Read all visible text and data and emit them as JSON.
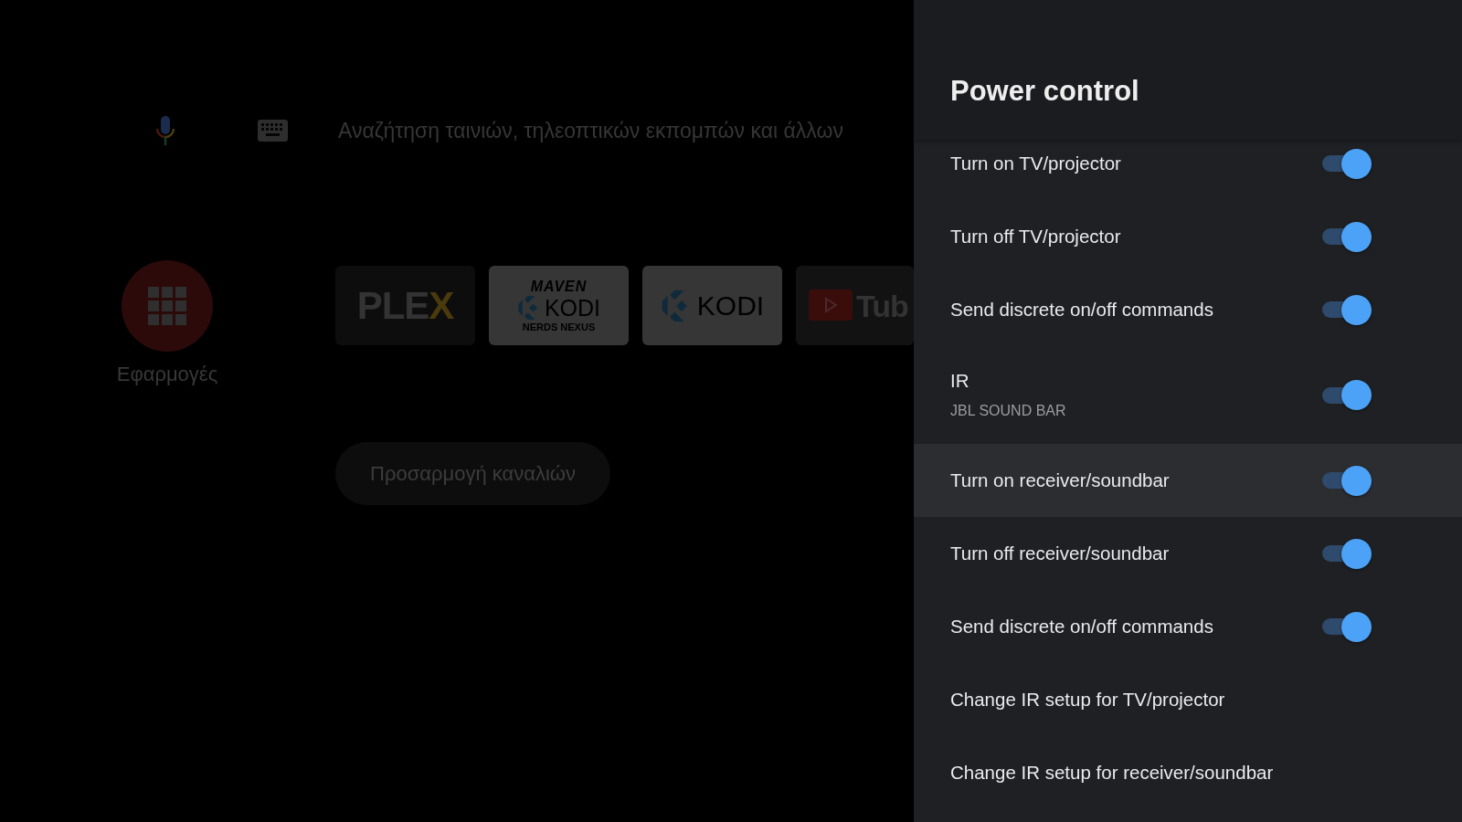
{
  "home": {
    "search": {
      "placeholder": "Αναζήτηση ταινιών, τηλεοπτικών εκπομπών και άλλων"
    },
    "apps_button": {
      "label": "Εφαρμογές"
    },
    "app_tiles": [
      {
        "kind": "plex",
        "texts": [
          "PLEX"
        ]
      },
      {
        "kind": "kodi-build",
        "texts": [
          "MAVEN",
          "KODI",
          "NERDS NEXUS"
        ]
      },
      {
        "kind": "kodi",
        "texts": [
          "KODI"
        ]
      },
      {
        "kind": "youtube",
        "texts": [
          "Tub"
        ]
      }
    ],
    "customize_channels_button": {
      "label": "Προσαρμογή καναλιών"
    }
  },
  "panel": {
    "title": "Power control",
    "items": [
      {
        "kind": "toggle",
        "label": "Turn on TV/projector",
        "on": true,
        "selected": false
      },
      {
        "kind": "toggle",
        "label": "Turn off TV/projector",
        "on": true,
        "selected": false
      },
      {
        "kind": "toggle",
        "label": "Send discrete on/off commands",
        "on": true,
        "selected": false
      },
      {
        "kind": "toggle",
        "label": "IR",
        "subtitle": "JBL SOUND BAR",
        "on": true,
        "selected": false
      },
      {
        "kind": "toggle",
        "label": "Turn on receiver/soundbar",
        "on": true,
        "selected": true
      },
      {
        "kind": "toggle",
        "label": "Turn off receiver/soundbar",
        "on": true,
        "selected": false
      },
      {
        "kind": "toggle",
        "label": "Send discrete on/off commands",
        "on": true,
        "selected": false
      },
      {
        "kind": "link",
        "label": "Change IR setup for TV/projector",
        "selected": false
      },
      {
        "kind": "link",
        "label": "Change IR setup for receiver/soundbar",
        "selected": false
      }
    ]
  }
}
